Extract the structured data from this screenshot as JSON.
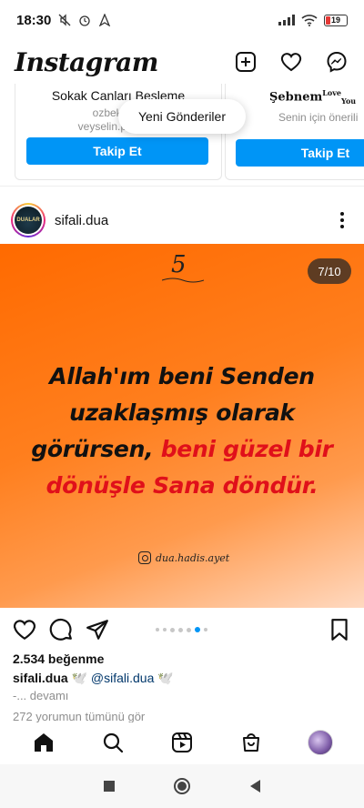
{
  "status_bar": {
    "time": "18:30",
    "battery": "19"
  },
  "header": {
    "logo": "Instagram"
  },
  "suggestions": {
    "cards": [
      {
        "name": "Sokak Canları Besleme",
        "sub1": "ozbekveys",
        "sub2": "veyselin.patileri_",
        "button": "Takip Et"
      },
      {
        "name": "Şebnem",
        "name_sup1": "Love",
        "name_sup2": "You",
        "sub1": "Senin için önerili",
        "button": "Takip Et"
      }
    ],
    "pill": "Yeni Gönderiler"
  },
  "post": {
    "username": "sifali.dua",
    "avatar_text": "DUALAR",
    "slide_number": "5",
    "page_indicator": "7/10",
    "quote_black_1": "Allah'ım beni Senden",
    "quote_black_2": "uzaklaşmış olarak",
    "quote_black_3": "görürsen,",
    "quote_red_1": "beni güzel bir",
    "quote_red_2": "dönüşle Sana döndür.",
    "watermark": "dua.hadis.ayet",
    "likes": "2.534 beğenme",
    "caption_user": "sifali.dua",
    "caption_emoji": "🕊️",
    "caption_mention": "@sifali.dua",
    "caption_emoji2": "🕊️",
    "more": "-... devamı",
    "comments": "272 yorumun tümünü gör",
    "carousel_dots": 7,
    "active_dot": 6
  },
  "icons": {
    "header": [
      "plus-square-icon",
      "heart-icon",
      "messenger-icon"
    ],
    "actions": [
      "heart-icon",
      "comment-icon",
      "share-icon",
      "bookmark-icon"
    ],
    "bottom_nav": [
      "home-icon",
      "search-icon",
      "reels-icon",
      "shop-icon",
      "profile-avatar"
    ],
    "system_nav": [
      "recent-apps-icon",
      "home-circle-icon",
      "back-icon"
    ]
  },
  "colors": {
    "accent": "#0095f6",
    "quote_red": "#e0101a",
    "post_bg": "#ff6a00"
  }
}
